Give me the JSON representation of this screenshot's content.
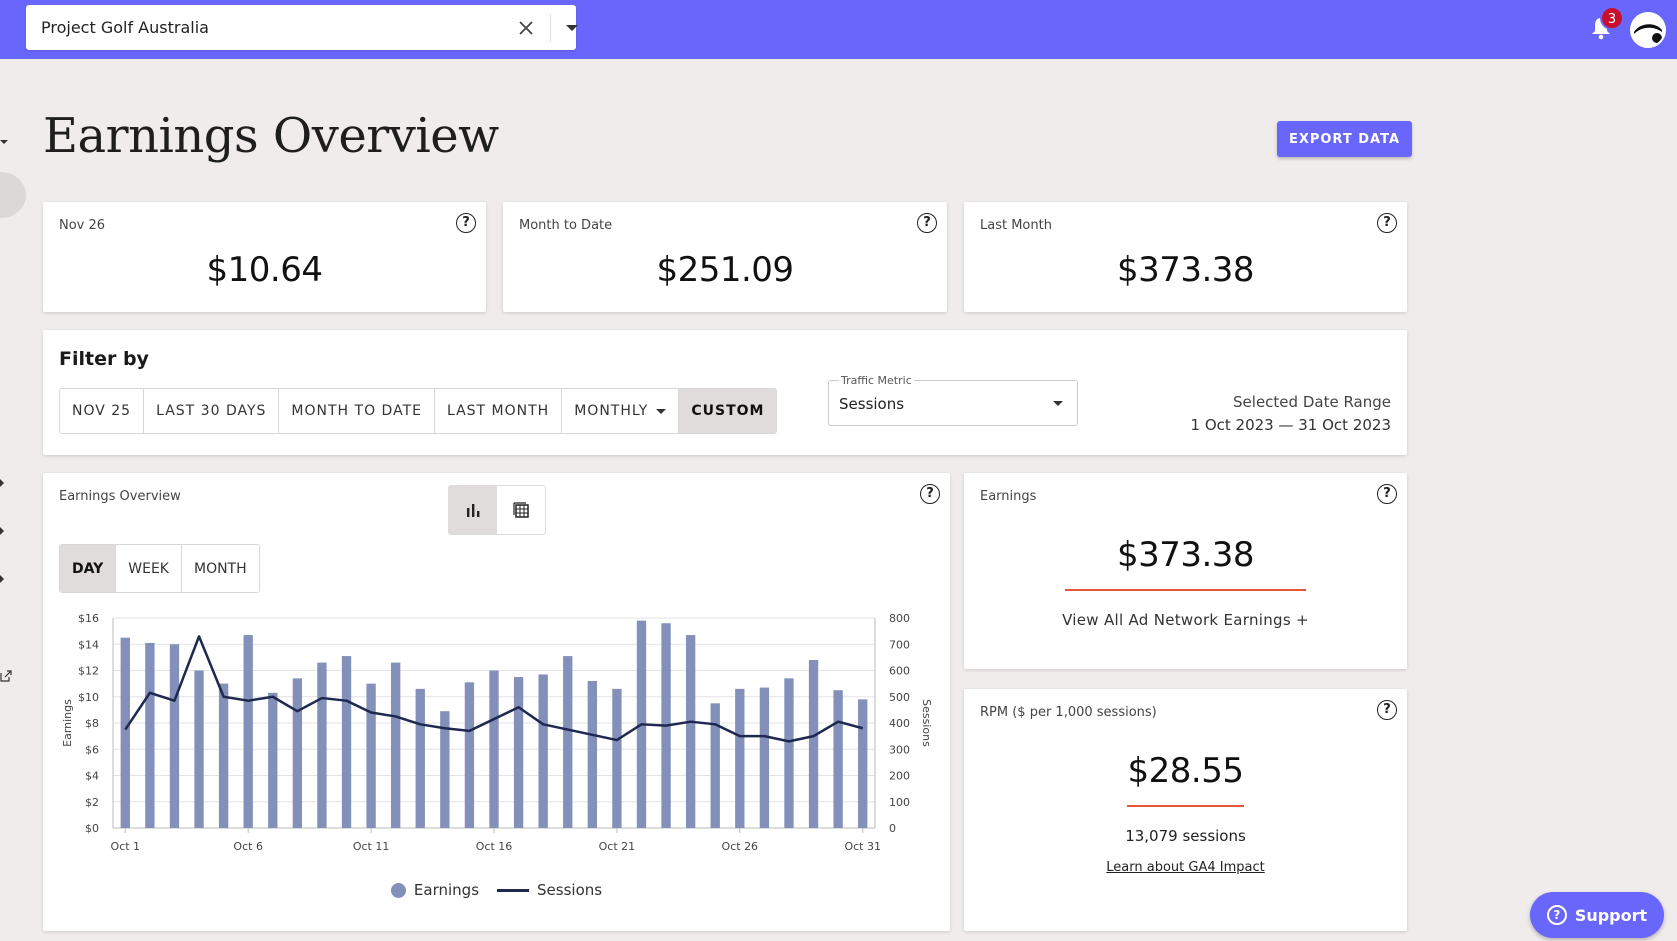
{
  "header": {
    "site_select": {
      "value": "Project Golf Australia"
    },
    "notifications": {
      "count": "3"
    }
  },
  "page": {
    "title": "Earnings Overview",
    "export_label": "EXPORT DATA"
  },
  "summary_cards": [
    {
      "label": "Nov 26",
      "value": "$10.64"
    },
    {
      "label": "Month to Date",
      "value": "$251.09"
    },
    {
      "label": "Last Month",
      "value": "$373.38"
    }
  ],
  "filter": {
    "title": "Filter by",
    "buttons": [
      "NOV 25",
      "LAST 30 DAYS",
      "MONTH TO DATE",
      "LAST MONTH",
      "MONTHLY",
      "CUSTOM"
    ],
    "active": "CUSTOM",
    "traffic_metric": {
      "label": "Traffic Metric",
      "value": "Sessions"
    },
    "date_range": {
      "label": "Selected Date Range",
      "value": "1 Oct 2023 — 31 Oct 2023"
    }
  },
  "chart_panel": {
    "label": "Earnings Overview",
    "granularity": [
      "DAY",
      "WEEK",
      "MONTH"
    ],
    "active_granularity": "DAY"
  },
  "chart_data": {
    "type": "bar",
    "ylabel": "Earnings",
    "y2label": "Sessions",
    "ylim": [
      0,
      16
    ],
    "y2lim": [
      0,
      800
    ],
    "yticks": [
      "$0",
      "$2",
      "$4",
      "$6",
      "$8",
      "$10",
      "$12",
      "$14",
      "$16"
    ],
    "y2ticks": [
      "0",
      "100",
      "200",
      "300",
      "400",
      "500",
      "600",
      "700",
      "800"
    ],
    "x_tick_labels": [
      "Oct 1",
      "Oct 6",
      "Oct 11",
      "Oct 16",
      "Oct 21",
      "Oct 26",
      "Oct 31"
    ],
    "x_tick_days": [
      1,
      6,
      11,
      16,
      21,
      26,
      31
    ],
    "days": [
      1,
      2,
      3,
      4,
      5,
      6,
      7,
      8,
      9,
      10,
      11,
      12,
      13,
      14,
      15,
      16,
      17,
      18,
      19,
      20,
      21,
      22,
      23,
      24,
      25,
      26,
      27,
      28,
      29,
      30,
      31
    ],
    "series": [
      {
        "name": "Earnings",
        "type": "bar",
        "axis": "left",
        "values": [
          14.5,
          14.1,
          14.0,
          12.0,
          11.0,
          14.7,
          10.3,
          11.4,
          12.6,
          13.1,
          11.0,
          12.6,
          10.6,
          8.9,
          11.1,
          12.0,
          11.5,
          11.7,
          13.1,
          11.2,
          10.6,
          15.8,
          15.6,
          14.7,
          9.5,
          10.6,
          10.7,
          11.4,
          12.8,
          10.5,
          9.8
        ]
      },
      {
        "name": "Sessions",
        "type": "line",
        "axis": "right",
        "values": [
          375,
          515,
          485,
          730,
          500,
          485,
          500,
          445,
          495,
          485,
          440,
          425,
          395,
          380,
          370,
          415,
          460,
          395,
          375,
          355,
          335,
          395,
          390,
          405,
          395,
          350,
          350,
          330,
          350,
          405,
          380
        ]
      }
    ],
    "legend": [
      "Earnings",
      "Sessions"
    ]
  },
  "earnings_card": {
    "label": "Earnings",
    "value": "$373.38",
    "link": "View All Ad Network Earnings +"
  },
  "rpm_card": {
    "label": "RPM ($ per 1,000 sessions)",
    "value": "$28.55",
    "sessions": "13,079 sessions",
    "link": "Learn about GA4 Impact"
  },
  "support": {
    "label": "Support"
  },
  "colors": {
    "accent": "#6967fb",
    "bar": "#8390b9",
    "line": "#1f2850",
    "underline": "#e8553d",
    "badge": "#c8102e"
  }
}
